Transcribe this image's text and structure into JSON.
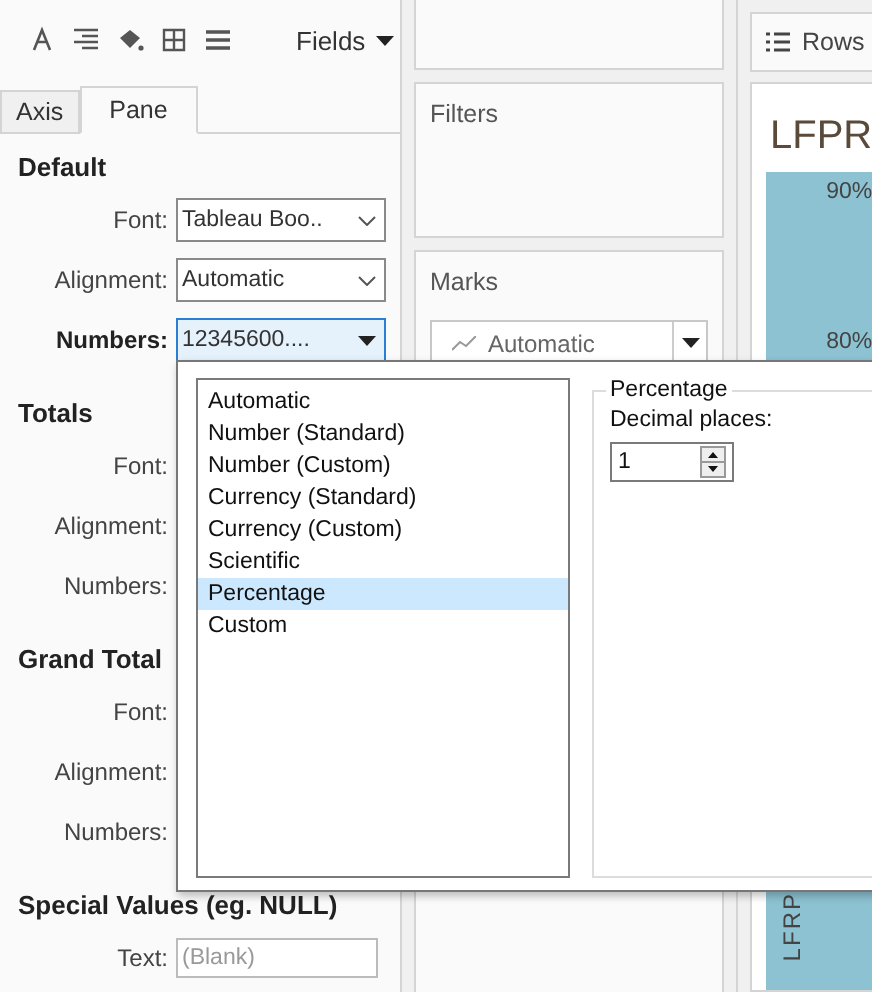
{
  "toolbar": {
    "fields_menu": "Fields"
  },
  "tabs": [
    {
      "label": "Axis",
      "selected": false
    },
    {
      "label": "Pane",
      "selected": true
    }
  ],
  "sections": [
    {
      "title": "Default",
      "rows": [
        {
          "label": "Font:",
          "kind": "select",
          "value": "Tableau Boo..",
          "focused": false
        },
        {
          "label": "Alignment:",
          "kind": "select",
          "value": "Automatic",
          "focused": false
        },
        {
          "label": "Numbers:",
          "kind": "select",
          "value": "12345600....",
          "focused": true
        }
      ]
    },
    {
      "title": "Totals",
      "rows": [
        {
          "label": "Font:",
          "kind": "covered",
          "focused": false
        },
        {
          "label": "Alignment:",
          "kind": "covered",
          "focused": false
        },
        {
          "label": "Numbers:",
          "kind": "covered",
          "focused": false
        }
      ]
    },
    {
      "title": "Grand Total",
      "rows": [
        {
          "label": "Font:",
          "kind": "covered",
          "focused": false
        },
        {
          "label": "Alignment:",
          "kind": "covered",
          "focused": false
        },
        {
          "label": "Numbers:",
          "kind": "covered",
          "focused": false
        }
      ]
    },
    {
      "title": "Special Values (eg. NULL)",
      "rows": [
        {
          "label": "Text:",
          "kind": "input",
          "placeholder": "(Blank)",
          "focused": false
        }
      ]
    }
  ],
  "filters": {
    "title": "Filters"
  },
  "marks": {
    "title": "Marks",
    "mark_type": "Automatic"
  },
  "rows_shelf": {
    "label": "Rows"
  },
  "chart": {
    "title": "LFPR",
    "axis_labels": [
      "90%",
      "80%"
    ],
    "vertical_label": "LFRP"
  },
  "format_popup": {
    "options": [
      {
        "label": "Automatic",
        "selected": false
      },
      {
        "label": "Number (Standard)",
        "selected": false
      },
      {
        "label": "Number (Custom)",
        "selected": false
      },
      {
        "label": "Currency (Standard)",
        "selected": false
      },
      {
        "label": "Currency (Custom)",
        "selected": false
      },
      {
        "label": "Scientific",
        "selected": false
      },
      {
        "label": "Percentage",
        "selected": true
      },
      {
        "label": "Custom",
        "selected": false
      }
    ],
    "group_title": "Percentage",
    "decimal_label": "Decimal places:",
    "decimal_value": "1"
  }
}
